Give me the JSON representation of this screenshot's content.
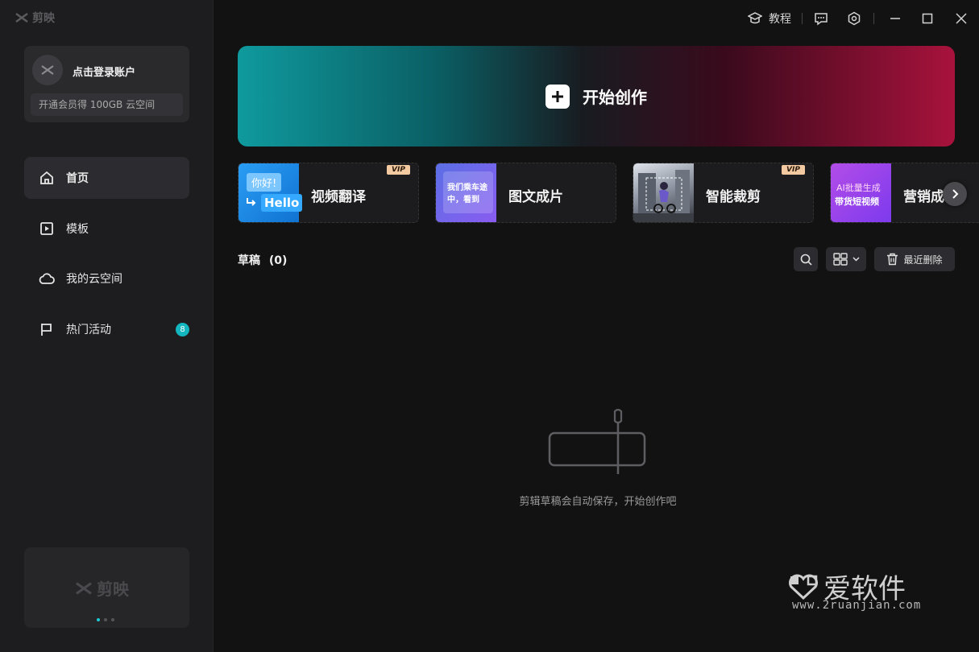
{
  "app": {
    "logo_text": "剪映"
  },
  "topbar": {
    "tutorial_label": "教程"
  },
  "account": {
    "login_label": "点击登录账户",
    "vip_promo": "开通会员得 100GB 云空间"
  },
  "sidebar": {
    "items": [
      {
        "label": "首页",
        "icon": "home-icon",
        "active": true
      },
      {
        "label": "模板",
        "icon": "template-icon",
        "active": false
      },
      {
        "label": "我的云空间",
        "icon": "cloud-icon",
        "active": false
      },
      {
        "label": "热门活动",
        "icon": "flag-icon",
        "active": false,
        "badge": "8"
      }
    ],
    "promo_logo_text": "剪映"
  },
  "create": {
    "label": "开始创作"
  },
  "tools": [
    {
      "label": "视频翻译",
      "vip": true,
      "thumb_text": [
        "你好!",
        "Hello"
      ]
    },
    {
      "label": "图文成片",
      "vip": false,
      "thumb_text": [
        "我们乘车途",
        "中，看到"
      ]
    },
    {
      "label": "智能裁剪",
      "vip": true,
      "thumb_text": []
    },
    {
      "label": "营销成",
      "vip": false,
      "thumb_text": [
        "AI批量生成",
        "带货短视频"
      ]
    }
  ],
  "vip_tag": "VIP",
  "drafts": {
    "title": "草稿",
    "count": "(0)",
    "recent_delete_label": "最近删除",
    "empty_text": "剪辑草稿会自动保存，开始创作吧"
  },
  "watermark": {
    "main": "爱软件",
    "sub": "www.2ruanjian.com"
  },
  "colors": {
    "accent": "#13b5bf",
    "banner_left": "#0f9a9e",
    "banner_right": "#a8123c",
    "vip": "#f2c9a0"
  }
}
